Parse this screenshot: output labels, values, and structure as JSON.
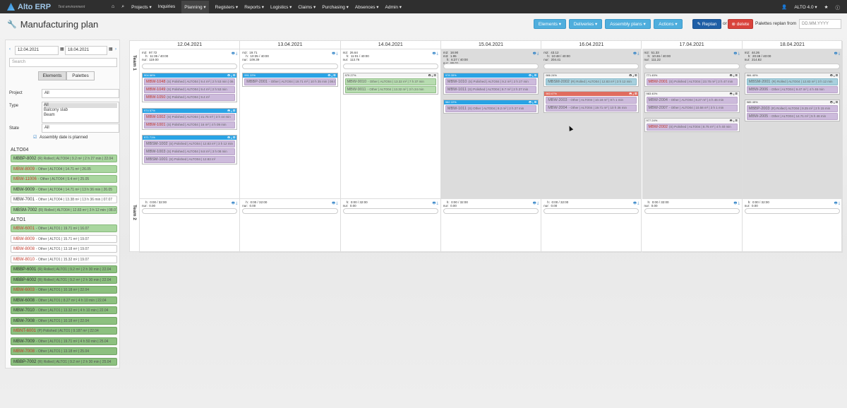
{
  "app": {
    "brand": "Alto ERP",
    "environment": "Test environment",
    "version": "ALTO 4.0 ▾"
  },
  "nav": {
    "home_icon": "home-icon",
    "search_icon": "search-icon",
    "items": [
      "Projects ▾",
      "Inquiries",
      "Planning ▾",
      "Registers ▾",
      "Reports ▾",
      "Logistics ▾",
      "Claims ▾",
      "Purchasing ▾",
      "Absences ▾",
      "Admin ▾"
    ]
  },
  "page": {
    "title": "Manufacturing plan",
    "buttons": {
      "elements": "Elements ▾",
      "deliveries": "Deliveries ▾",
      "assembly": "Assembly plans ▾",
      "actions": "Actions ▾",
      "replan": "Replan",
      "or": "or",
      "delete": "delete",
      "replan_from": "Palettes replan from",
      "date_placeholder": "DD.MM.YYYY"
    }
  },
  "sidebar": {
    "date_from": "12.04.2021",
    "date_to": "18.04.2021",
    "search_placeholder": "Search",
    "toggle": [
      "Elements",
      "Palettes"
    ],
    "project_label": "Project",
    "project_value": "All",
    "type_label": "Type",
    "type_options": [
      "All",
      "Balcony slab",
      "Beam"
    ],
    "state_label": "State",
    "state_value": "All",
    "assembly_checkbox": "Assembly date is planned",
    "groups": [
      {
        "title": "ALTO04",
        "items": [
          {
            "code": "MBBP-8002",
            "text": "(R) Rolled | ALTO04 | 9.2 m² | 2 h 27 min | 22.04",
            "style": "g1"
          },
          {
            "code": "MBW-8009",
            "text": "- Other | ALTO04 | 14.71 m² | 26.05",
            "style": "g1",
            "red": true
          },
          {
            "code": "MBW-11006",
            "text": "- Other | ALTO04 | 9.4 m² | 25.05",
            "style": "g1",
            "red": true
          },
          {
            "code": "MBW-9009",
            "text": "- Other | ALTO04 | 14.71 m² | 13 h 36 min | 26.05",
            "style": "g1"
          },
          {
            "code": "MBW-7001",
            "text": "- Other | ALTO04 | 13.38 m² | 13 h 36 min | 07.07",
            "style": "w"
          },
          {
            "code": "MBSM-7002",
            "text": "(R) Rolled | ALTO04 | 12.83 m² | 3 h 12 min | 08.07",
            "style": "g1"
          }
        ]
      },
      {
        "title": "ALTO1",
        "items": [
          {
            "code": "MBW-6001",
            "text": "- Other | ALTO1 | 19.71 m² | 16.07",
            "style": "g1",
            "red": true
          },
          {
            "code": "MBW-8009",
            "text": "- Other | ALTO1 | 15.71 m² | 19.07",
            "style": "w",
            "red": true
          },
          {
            "code": "MBW-8008",
            "text": "- Other | ALTO1 | 13.18 m² | 19.07",
            "style": "w",
            "red": true
          },
          {
            "code": "MBW-8010",
            "text": "- Other | ALTO1 | 15.32 m² | 19.07",
            "style": "w",
            "red": true
          },
          {
            "code": "MBBP-6001",
            "text": "(R) Rolled | ALTO1 | 9.2 m² | 2 h 30 min | 22.04",
            "style": "g2"
          },
          {
            "code": "MBBP-6002",
            "text": "(R) Rolled | ALTO1 | 9.2 m² | 2 h 30 min | 22.04",
            "style": "g2"
          },
          {
            "code": "MBW-6003",
            "text": "- Other | ALTO1 | 10.18 m² | 22.04",
            "style": "g2",
            "red": true
          },
          {
            "code": "MBW-6008",
            "text": "- Other | ALTO1 | 8.27 m² | 4 h 10 min | 22.04",
            "style": "g2"
          },
          {
            "code": "MBW-7010",
            "text": "- Other | ALTO1 | 13.32 m² | 4 h 10 min | 22.04",
            "style": "g2"
          },
          {
            "code": "MBW-7008",
            "text": "- Other | ALTO1 | 10.18 m² | 22.04",
            "style": "g2"
          },
          {
            "code": "MBNT-6001",
            "text": "(P) Polished | ALTO1 | 9.187 m² | 22.04",
            "style": "g2",
            "red": true
          },
          {
            "code": "MBW-7009",
            "text": "- Other | ALTO1 | 19.71 m² | 4 h 50 min | 25.04",
            "style": "g2"
          },
          {
            "code": "MBW-7008",
            "text": "- Other | ALTO1 | 13.18 m² | 25.04",
            "style": "g2",
            "red": true
          },
          {
            "code": "MBBP-7002",
            "text": "(R) Rolled | ALTO1 | 9.2 m² | 2 h 30 min | 25.04",
            "style": "g2"
          }
        ]
      }
    ]
  },
  "planner": {
    "teams": [
      "Team 1",
      "Team 2"
    ],
    "days": [
      {
        "date": "12.04.2021",
        "stats": "m2:  97.72\n    h:  11:35 / 40:00\nnur:  119.00",
        "grey": false,
        "cards": [
          {
            "bar": "blue",
            "label": "904 66%",
            "els": [
              [
                "MBW-1048",
                "(S) Polished | ALTO04 | 9.4 m² | 2 h 53 min | 08.06",
                "red"
              ],
              [
                "MBW-1049",
                "(S) Polished | ALTO04 | 9.4 m² | 2 h 53 min",
                "red"
              ],
              [
                "MBW-1050",
                "(S) Polished | ALTO04 | 9.4 m²",
                "red"
              ]
            ]
          },
          {
            "bar": "blue",
            "label": "974 57%",
            "els": [
              [
                "MBW-1002",
                "(S) Polished | ALTO04 | 21.75 m² | 3 h 44 min",
                "red"
              ],
              [
                "MBW-1001",
                "(S) Polished | ALTO04 | 16 m² | 4 h 09 min",
                "red"
              ]
            ]
          },
          {
            "bar": "blue",
            "label": "971 71%",
            "els": [
              [
                "MBSM-1002",
                "(S) Polished | ALTO04 | 12.83 m² | 3 h 12 min",
                ""
              ],
              [
                "MBW-1003",
                "(S) Polished | ALTO04 | 9.8 m² | 3 h 08 min",
                ""
              ],
              [
                "MBSM-1001",
                "(S) Polished | ALTO04 | 12.83 m²",
                ""
              ]
            ]
          }
        ]
      },
      {
        "date": "13.04.2021",
        "stats": "m2:  19.71\n    h:  10:35 / 40:00\nnur:  109.39",
        "grey": false,
        "cards": [
          {
            "bar": "blue",
            "label": "991 22%",
            "els": [
              [
                "MBBP-2001",
                "- Other | ALTO04 | 19.71 m² | 10 h 35 min | 08.06",
                ""
              ]
            ]
          }
        ]
      },
      {
        "date": "14.04.2021",
        "stats": "m2:  26.64\n    h:  11:01 / 40:00\nnur:  113.76",
        "grey": false,
        "cards": [
          {
            "bar": "white",
            "label": "979 27%",
            "els": [
              [
                "MBW-9010",
                "- Other | ALTO04 | 13.32 m² | 7 h 37 min",
                "green"
              ],
              [
                "MBW-9011",
                "- Other | ALTO04 | 13.32 m² | 3 h 24 min",
                "green"
              ]
            ]
          }
        ]
      },
      {
        "date": "15.04.2021",
        "stats": "m2:  18.90\nm3:  1.95\n    h:  6:27 / 40:00\nnur:  86.01",
        "grey": true,
        "cards": [
          {
            "bar": "blue",
            "label": "978 35%",
            "els": [
              [
                "MBW-1010",
                "(S) Polished | ALTO04 | 9.2 m² | 2 h 27 min",
                ""
              ],
              [
                "MBW-1011",
                "(S) Polished | ALTO04 | 9.7 m² | 2 h 27 min",
                ""
              ]
            ]
          },
          {
            "bar": "blue",
            "label": "982 22%",
            "els": [
              [
                "MBW-1011",
                "(S) Other | ALTO04 | 9.2 m² | 2 h 27 min",
                ""
              ]
            ]
          }
        ]
      },
      {
        "date": "16.04.2021",
        "stats": "m2:  43.12\n    h:  10:48 / 40:00\nnur:  204.41",
        "grey": true,
        "cards": [
          {
            "bar": "white",
            "label": "986 24%",
            "els": [
              [
                "MBSM-2002",
                "(R) Rolled | ALTO04 | 12.83 m² | 3 h 12 min",
                "teal"
              ]
            ]
          },
          {
            "bar": "red",
            "label": "983 67%",
            "els": [
              [
                "MBW-2003",
                "- Other | ALTO04 | 10.18 m² | 8 h 1 min",
                ""
              ],
              [
                "MBW-2004",
                "- Other | ALTO04 | 19.71 m² | 10 h 36 min",
                ""
              ]
            ]
          }
        ]
      },
      {
        "date": "17.04.2021",
        "stats": "m2:  51.33\n    h:  10:46 / 40:00\nnur:  111.22",
        "grey": true,
        "cards": [
          {
            "bar": "white",
            "label": "771 45%",
            "els": [
              [
                "MBW-2001",
                "(S) Polished | ALTO04 | 23.75 m² | 2 h 47 min",
                "red"
              ]
            ]
          },
          {
            "bar": "white",
            "label": "983 40%",
            "els": [
              [
                "MBW-2004",
                "- Other | ALTO04 | 8.27 m² | 4 h 46 min",
                ""
              ],
              [
                "MBW-2007",
                "- Other | ALTO04 | 10.58 m² | 3 h 1 min",
                ""
              ]
            ]
          },
          {
            "bar": "white",
            "label": "977 24%",
            "els": [
              [
                "MBW-2002",
                "(S) Polished | ALTO04 | 8.75 m² | 4 h 40 min",
                "red"
              ]
            ]
          }
        ]
      },
      {
        "date": "18.04.2021",
        "stats": "m2:  44.26\n    h:  20:48 / 40:00\nnur:  214.82",
        "grey": true,
        "cards": [
          {
            "bar": "white",
            "label": "984 40%",
            "els": [
              [
                "MBSM-2001",
                "(R) Rolled | ALTO04 | 12.83 m² | 3 h 12 min",
                "teal"
              ],
              [
                "MBW-2006",
                "- Other | ALTO04 | 9.47 m² | 4 h 46 min",
                ""
              ]
            ]
          },
          {
            "bar": "white",
            "label": "985 45%",
            "els": [
              [
                "MBBP-2003",
                "(R) Rolled | ALTO04 | 9.25 m² | 2 h 15 min",
                ""
              ],
              [
                "MBW-2005",
                "- Other | ALTO04 | 14.71 m² | 5 h 46 min",
                ""
              ]
            ]
          }
        ]
      }
    ],
    "team2_stats": "    h:  0:00 / 32:00\nnur:  0.00"
  }
}
